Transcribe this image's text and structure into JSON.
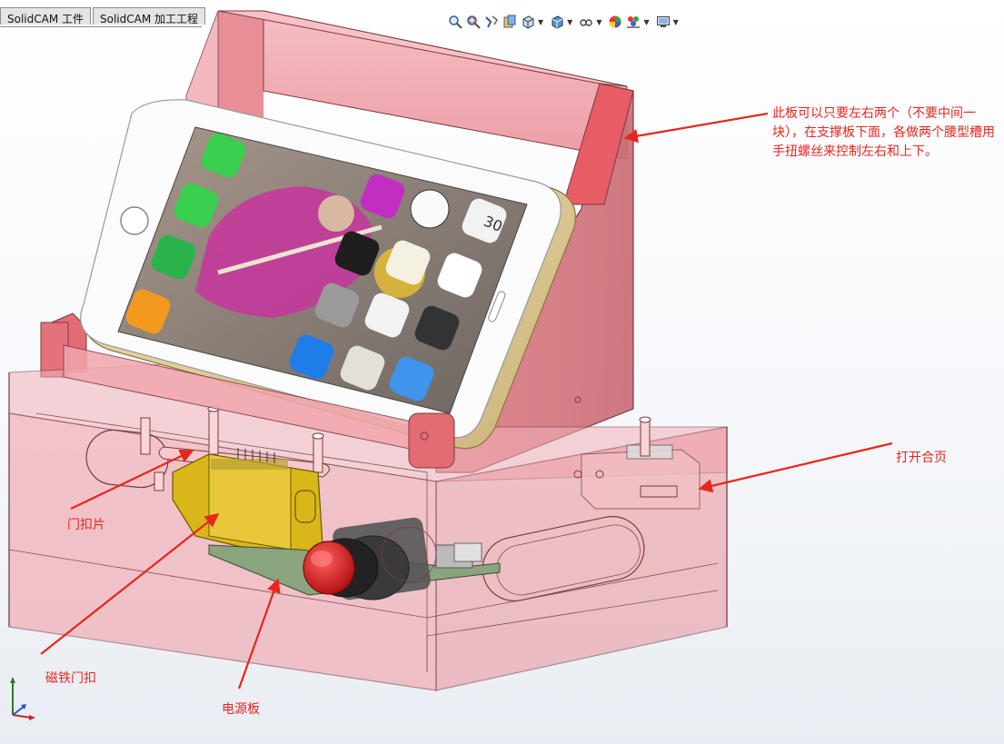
{
  "tabs": [
    "SolidCAM 工件",
    "SolidCAM 加工工程"
  ],
  "toolbar": {
    "icons": [
      "zoom-to-fit-icon",
      "zoom-area-icon",
      "previous-view-icon",
      "section-view-icon",
      "view-orientation-icon",
      "display-style-icon",
      "hide-show-icon",
      "edit-appearance-icon",
      "apply-scene-icon",
      "view-settings-icon"
    ]
  },
  "annotations": {
    "support_plate": "此板可以只要左右两个（不要中间一块），在支撑板下面，各做两个腰型槽用手扭螺丝来控制左右和上下。",
    "hinge": "打开合页",
    "door_latch_plate": "门扣片",
    "magnetic_latch": "磁铁门扣",
    "power_board": "电源板"
  },
  "phone": {
    "time_widget": "30"
  },
  "colors": {
    "enclosure": "#f2a4ab",
    "enclosure_edge": "#7a3a40",
    "annotation": "#e8261c",
    "latch": "#d9b61a",
    "button": "#d81e1e"
  }
}
